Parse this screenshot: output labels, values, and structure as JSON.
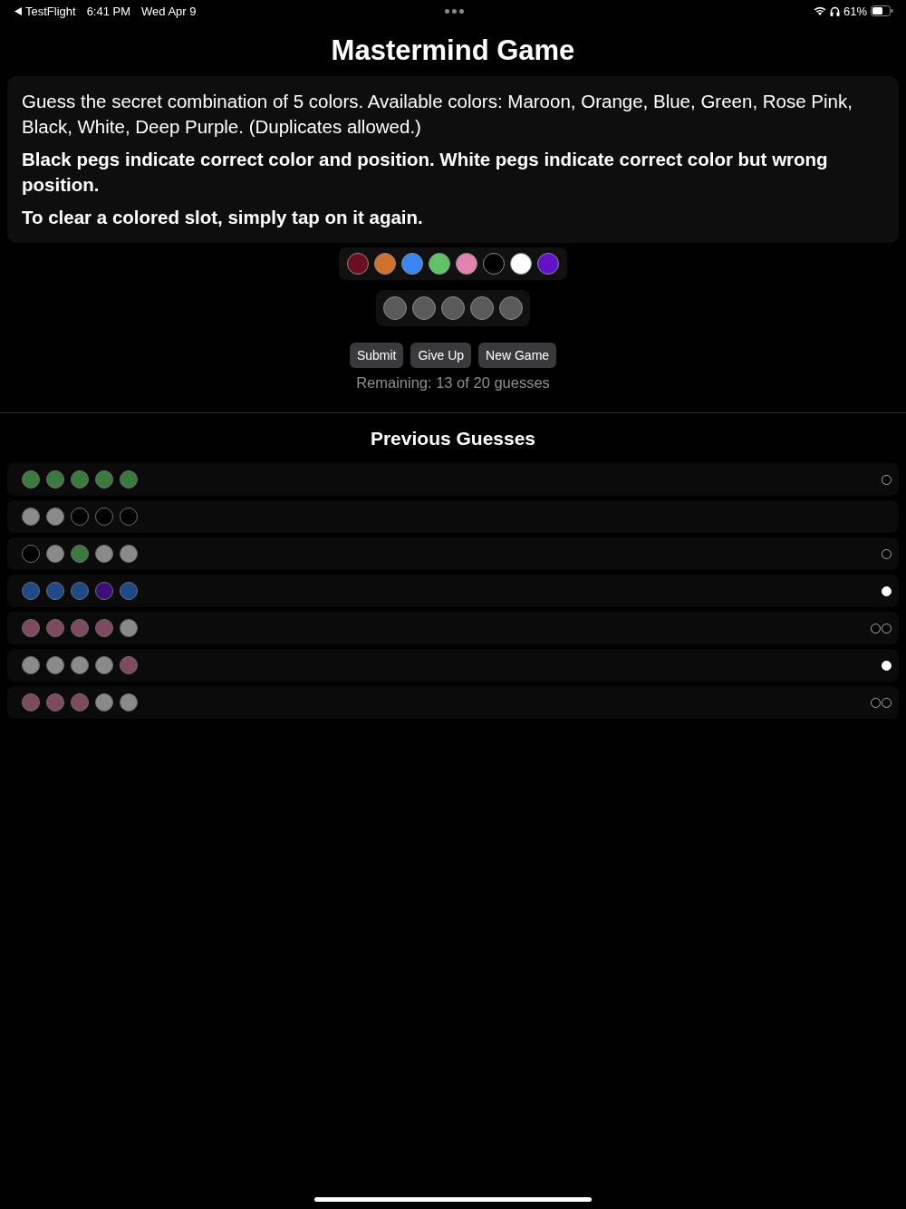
{
  "status_bar": {
    "back_label": "TestFlight",
    "time": "6:41 PM",
    "date": "Wed Apr 9",
    "battery": "61%"
  },
  "title": "Mastermind Game",
  "instructions": [
    {
      "text": "Guess the secret combination of 5 colors. Available colors: Maroon, Orange, Blue, Green, Rose Pink, Black, White, Deep Purple. (Duplicates allowed.)",
      "bold": false
    },
    {
      "text": "Black pegs indicate correct color and position. White pegs indicate correct color but wrong position.",
      "bold": true
    },
    {
      "text": "To clear a colored slot, simply tap on it again.",
      "bold": true
    }
  ],
  "palette": [
    {
      "color": "#6a0f20"
    },
    {
      "color": "#d2702e"
    },
    {
      "color": "#3a86f0"
    },
    {
      "color": "#5ec466"
    },
    {
      "color": "#e383b0"
    },
    {
      "color": "#000000"
    },
    {
      "color": "#ffffff"
    },
    {
      "color": "#6212c8"
    }
  ],
  "current_guess": [
    {
      "filled": false
    },
    {
      "filled": false
    },
    {
      "filled": false
    },
    {
      "filled": false
    },
    {
      "filled": false
    }
  ],
  "buttons": [
    "Submit",
    "Give Up",
    "New Game"
  ],
  "remaining": "Remaining: 13 of 20 guesses",
  "previous_guesses": {
    "title": "Previous Guesses",
    "rows": [
      {
        "pegs": [
          {
            "color": "#3b7a3f"
          },
          {
            "color": "#3b7a3f"
          },
          {
            "color": "#3b7a3f"
          },
          {
            "color": "#3b7a3f"
          },
          {
            "color": "#3b7a3f"
          }
        ],
        "feedback": [
          {
            "kind": "black"
          }
        ]
      },
      {
        "pegs": [
          {
            "color": "#8a8a8a"
          },
          {
            "color": "#8a8a8a"
          },
          {
            "color": "#000000"
          },
          {
            "color": "#000000"
          },
          {
            "color": "#000000"
          }
        ],
        "feedback": []
      },
      {
        "pegs": [
          {
            "color": "#000000"
          },
          {
            "color": "#8a8a8a"
          },
          {
            "color": "#3b7a3f"
          },
          {
            "color": "#8a8a8a"
          },
          {
            "color": "#8a8a8a"
          }
        ],
        "feedback": [
          {
            "kind": "black"
          }
        ]
      },
      {
        "pegs": [
          {
            "color": "#1f4a8a"
          },
          {
            "color": "#1f4a8a"
          },
          {
            "color": "#1f4a8a"
          },
          {
            "color": "#3a0f78"
          },
          {
            "color": "#1f4a8a"
          }
        ],
        "feedback": [
          {
            "kind": "white"
          }
        ]
      },
      {
        "pegs": [
          {
            "color": "#7d4a60"
          },
          {
            "color": "#7d4a60"
          },
          {
            "color": "#7d4a60"
          },
          {
            "color": "#7d4a60"
          },
          {
            "color": "#8a8a8a"
          }
        ],
        "feedback": [
          {
            "kind": "black"
          },
          {
            "kind": "black"
          }
        ]
      },
      {
        "pegs": [
          {
            "color": "#8a8a8a"
          },
          {
            "color": "#8a8a8a"
          },
          {
            "color": "#8a8a8a"
          },
          {
            "color": "#8a8a8a"
          },
          {
            "color": "#7d4a60"
          }
        ],
        "feedback": [
          {
            "kind": "white"
          }
        ]
      },
      {
        "pegs": [
          {
            "color": "#7d4a60"
          },
          {
            "color": "#7d4a60"
          },
          {
            "color": "#7d4a60"
          },
          {
            "color": "#8a8a8a"
          },
          {
            "color": "#8a8a8a"
          }
        ],
        "feedback": [
          {
            "kind": "black"
          },
          {
            "kind": "black"
          }
        ]
      }
    ]
  }
}
